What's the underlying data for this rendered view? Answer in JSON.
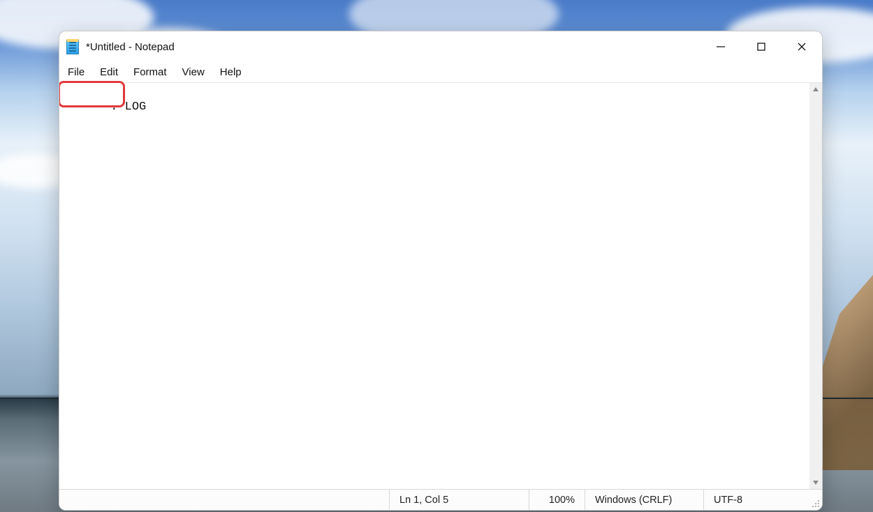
{
  "title": "*Untitled - Notepad",
  "menu": {
    "file": "File",
    "edit": "Edit",
    "format": "Format",
    "view": "View",
    "help": "Help"
  },
  "editor": {
    "content": ". LOG"
  },
  "status": {
    "position": "Ln 1, Col 5",
    "zoom": "100%",
    "line_ending": "Windows (CRLF)",
    "encoding": "UTF-8"
  }
}
